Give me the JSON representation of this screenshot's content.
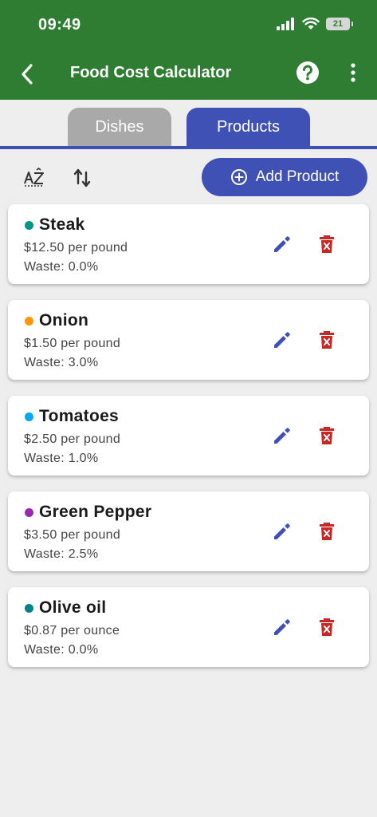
{
  "status": {
    "time": "09:49",
    "battery": "21"
  },
  "app_bar": {
    "title": "Food Cost Calculator"
  },
  "tabs": [
    {
      "label": "Dishes",
      "active": false
    },
    {
      "label": "Products",
      "active": true
    }
  ],
  "toolbar": {
    "add_label": "Add Product"
  },
  "products": [
    {
      "name": "Steak",
      "price": "$12.50 per pound",
      "waste": "Waste: 0.0%",
      "color": "#009688"
    },
    {
      "name": "Onion",
      "price": "$1.50 per pound",
      "waste": "Waste: 3.0%",
      "color": "#ff9800"
    },
    {
      "name": "Tomatoes",
      "price": "$2.50 per pound",
      "waste": "Waste: 1.0%",
      "color": "#03a9f4"
    },
    {
      "name": "Green Pepper",
      "price": "$3.50 per pound",
      "waste": "Waste: 2.5%",
      "color": "#9c27b0"
    },
    {
      "name": "Olive oil",
      "price": "$0.87 per ounce",
      "waste": "Waste: 0.0%",
      "color": "#00838f"
    }
  ],
  "colors": {
    "app_bar": "#2e7d32",
    "accent": "#3f51b5",
    "delete": "#c62828",
    "inactive_tab": "#a9a9a9"
  },
  "icons": [
    "back-arrow-icon",
    "help-icon",
    "more-vert-icon",
    "sort-alpha-icon",
    "swap-vert-icon",
    "add-circle-icon",
    "edit-icon",
    "delete-icon"
  ]
}
